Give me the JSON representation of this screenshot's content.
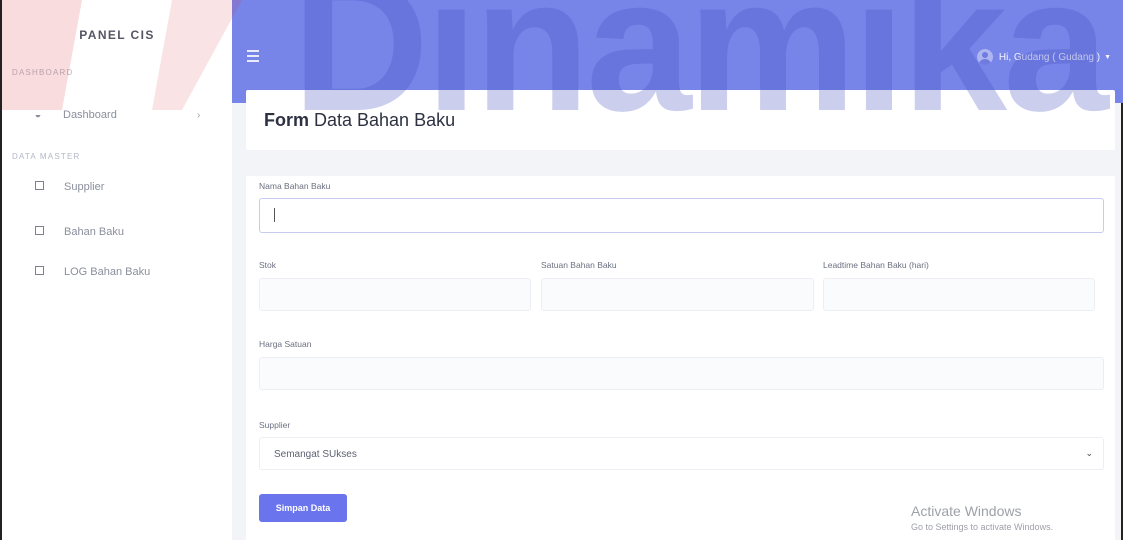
{
  "brand": {
    "name": "PANEL CIS"
  },
  "sidebar": {
    "headings": [
      "DASHBOARD",
      "DATA MASTER"
    ],
    "items": [
      {
        "label": "Dashboard",
        "icon": "palette-icon"
      },
      {
        "label": "Supplier",
        "icon": "square-icon"
      },
      {
        "label": "Bahan Baku",
        "icon": "square-icon"
      },
      {
        "label": "LOG Bahan Baku",
        "icon": "square-icon"
      }
    ]
  },
  "topbar": {
    "user_greeting": "Hi, Gudang ( Gudang )",
    "color": "#7784e8"
  },
  "page": {
    "title_strong": "Form",
    "title_rest": " Data Bahan Baku"
  },
  "form": {
    "nama_label": "Nama Bahan Baku",
    "nama_value": "",
    "stok_label": "Stok",
    "satuan_label": "Satuan Bahan Baku",
    "leadtime_label": "Leadtime Bahan Baku (hari)",
    "harga_label": "Harga Satuan",
    "supplier_label": "Supplier",
    "supplier_selected": "Semangat SUkses",
    "submit_label": "Simpan Data"
  },
  "watermark": {
    "logo_text": "Dinamika",
    "activate_title": "Activate Windows",
    "activate_sub": "Go to Settings to activate Windows."
  },
  "colors": {
    "accent": "#6a74ec",
    "topbar": "#7784e8"
  }
}
